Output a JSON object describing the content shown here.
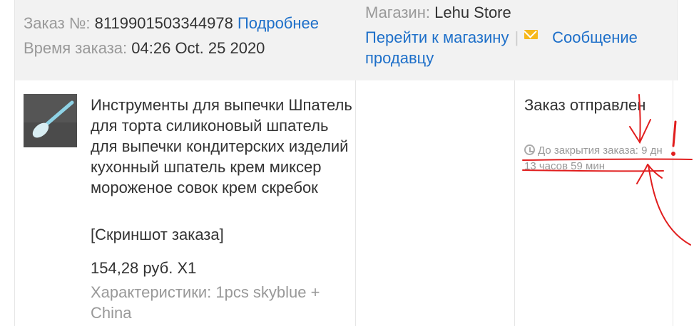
{
  "order": {
    "number_label": "Заказ №:",
    "number_value": "8119901503344978",
    "details_link": "Подробнее",
    "time_label": "Время заказа:",
    "time_value": "04:26 Oct. 25 2020"
  },
  "store": {
    "label": "Магазин:",
    "name": "Lehu Store",
    "go_to_store": "Перейти к магазину",
    "separator": "|",
    "message_line1": "Сообщение",
    "message_line2": "продавцу"
  },
  "product": {
    "title": "Инструменты для выпечки Шпатель для торта силиконовый шпатель для выпечки кондитерских изделий кухонный шпатель крем миксер мороженое совок крем скребок",
    "snapshot_link": "[Скриншот заказа]",
    "price": "154,28 руб. X1",
    "attributes": "Характеристики: 1pcs skyblue + China"
  },
  "status": {
    "text": "Заказ отправлен",
    "countdown": "До закрытия заказа: 9 дн 13 часов 59 мин"
  },
  "icons": {
    "mail": "envelope-icon",
    "clock": "clock-icon",
    "spatula": "spatula-image"
  },
  "colors": {
    "link": "#1d6fc9",
    "muted": "#999999",
    "header_bg": "#f2f2f2",
    "envelope": "#f6b81c",
    "annotation": "#e11e1e"
  }
}
